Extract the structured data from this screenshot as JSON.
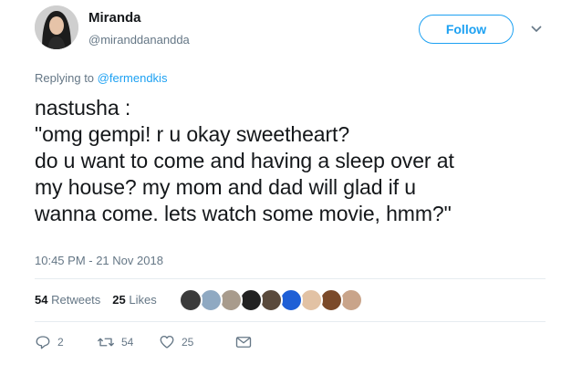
{
  "tweet": {
    "display_name": "Miranda",
    "handle": "@miranddanandda",
    "follow_label": "Follow",
    "replying_prefix": "Replying to",
    "replying_mention": "@fermendkis",
    "text": "nastusha :\n\"omg gempi! r u okay sweetheart?\ndo u want to come and having a sleep over at\nmy house? my mom and dad will glad if u\nwanna come. lets watch some movie, hmm?\"",
    "timestamp": "10:45 PM - 21 Nov 2018"
  },
  "stats": {
    "retweets_count": "54",
    "retweets_label": "Retweets",
    "likes_count": "25",
    "likes_label": "Likes"
  },
  "likers": [
    {
      "color": "#3b3b3b"
    },
    {
      "color": "#8fa9c2"
    },
    {
      "color": "#a89b8c"
    },
    {
      "color": "#222222"
    },
    {
      "color": "#5a4a3c"
    },
    {
      "color": "#1f5fd6"
    },
    {
      "color": "#e2c2a4"
    },
    {
      "color": "#7b4a2a"
    },
    {
      "color": "#c9a48a"
    }
  ],
  "actions": {
    "reply_count": "2",
    "retweet_count": "54",
    "like_count": "25"
  },
  "colors": {
    "accent": "#1da1f2",
    "secondary_text": "#657786",
    "divider": "#e6ecf0"
  },
  "icons": [
    "reply-icon",
    "retweet-icon",
    "heart-icon",
    "message-icon",
    "chevron-down-icon"
  ]
}
